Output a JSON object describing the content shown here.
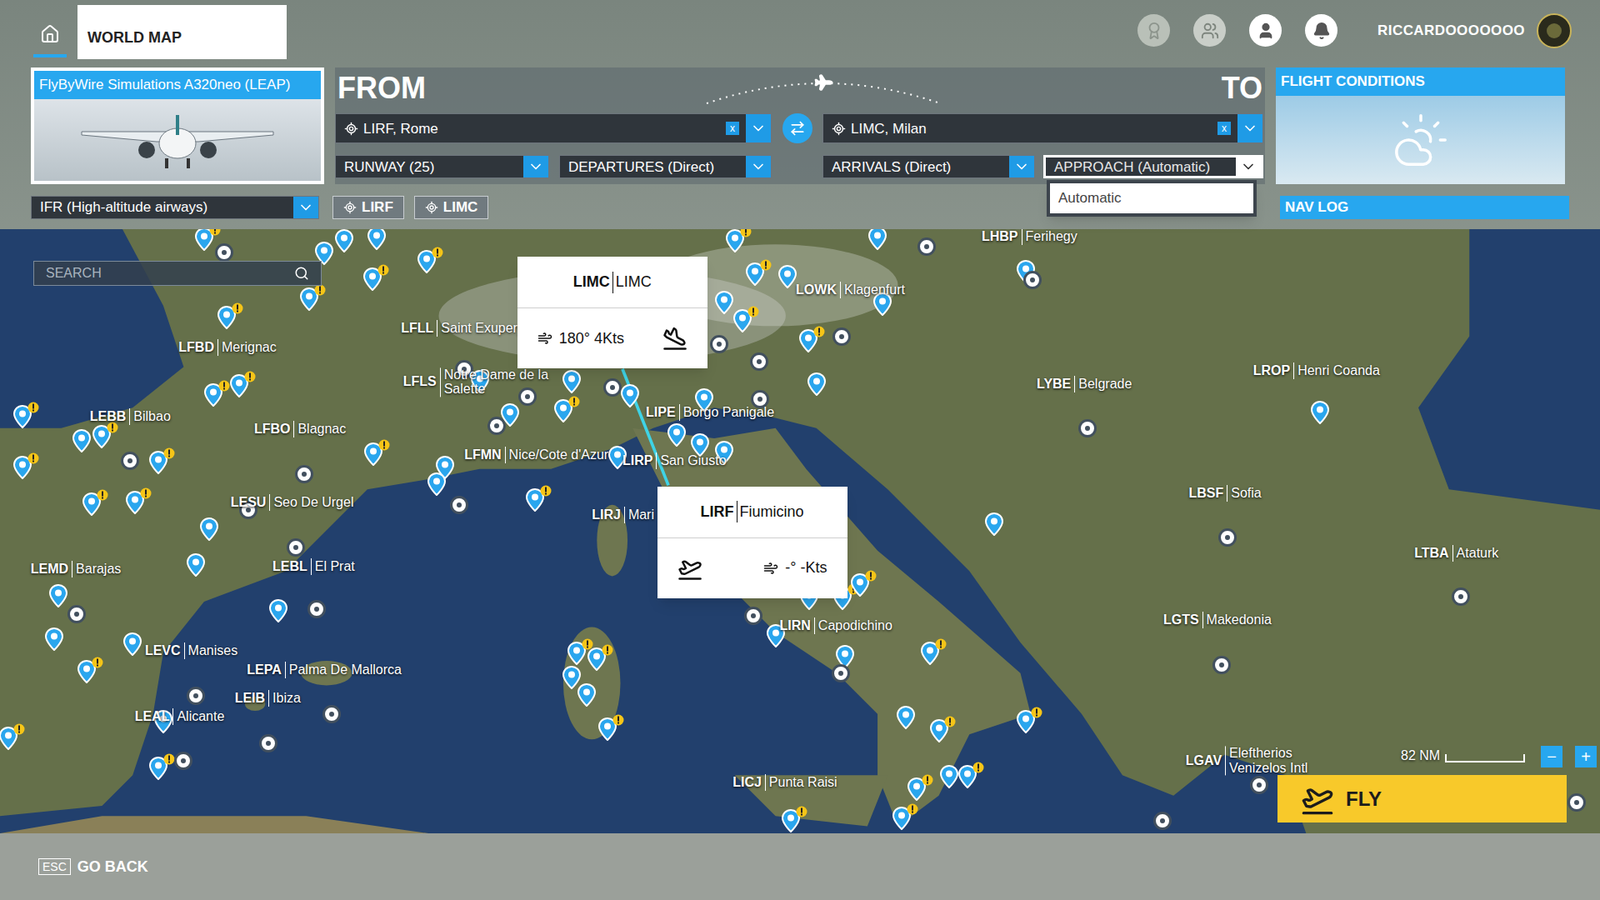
{
  "top_bar": {
    "tab": "WORLD MAP",
    "username": "RICCARDOOOOOOO"
  },
  "aircraft": {
    "name": "FlyByWire Simulations A320neo (LEAP)"
  },
  "route": {
    "from_label": "FROM",
    "to_label": "TO",
    "from": {
      "code": "LIRF",
      "name": "LIRF, Rome"
    },
    "to": {
      "code": "LIMC",
      "name": "LIMC, Milan"
    },
    "clear": "x",
    "runway": "RUNWAY (25)",
    "departures": "DEPARTURES (Direct)",
    "arrivals": "ARRIVALS (Direct)",
    "approach": "APPROACH (Automatic)"
  },
  "approach_menu": {
    "open": true,
    "options": [
      {
        "label": "Automatic",
        "selected": true
      }
    ]
  },
  "flight_conditions": {
    "title": "FLIGHT CONDITIONS"
  },
  "nav_log": "NAV LOG",
  "flight_type": "IFR (High-altitude airways)",
  "waypoints": [
    "LIRF",
    "LIMC"
  ],
  "search": {
    "placeholder": "SEARCH"
  },
  "map": {
    "labels": [
      {
        "code": "LHBP",
        "name": "Ferihegy"
      },
      {
        "code": "LROP",
        "name": "Henri Coanda"
      },
      {
        "code": "LYBE",
        "name": "Belgrade"
      },
      {
        "code": "LBSF",
        "name": "Sofia"
      },
      {
        "code": "LTBA",
        "name": "Ataturk"
      },
      {
        "code": "LGTS",
        "name": "Makedonia"
      },
      {
        "code": "LGAV",
        "name": "Eleftherios Venizelos Intl"
      },
      {
        "code": "LICJ",
        "name": "Punta Raisi"
      },
      {
        "code": "LIRN",
        "name": "Capodichino"
      },
      {
        "code": "LIRJ",
        "name": "Mari"
      },
      {
        "code": "LIRP",
        "name": "San Giusto"
      },
      {
        "code": "LIPE",
        "name": "Borgo Panigale"
      },
      {
        "code": "LFMN",
        "name": "Nice/Cote d'Azur"
      },
      {
        "code": "LFLL",
        "name": "Saint Exupery"
      },
      {
        "code": "LFLS",
        "name": "Notre Dame de la Salette"
      },
      {
        "code": "LFBD",
        "name": "Merignac"
      },
      {
        "code": "LEBB",
        "name": "Bilbao"
      },
      {
        "code": "LFBO",
        "name": "Blagnac"
      },
      {
        "code": "LESU",
        "name": "Seo De Urgel"
      },
      {
        "code": "LEBL",
        "name": "El Prat"
      },
      {
        "code": "LEMD",
        "name": "Barajas"
      },
      {
        "code": "LEVC",
        "name": "Manises"
      },
      {
        "code": "LEPA",
        "name": "Palma De Mallorca"
      },
      {
        "code": "LEIB",
        "name": "Ibiza"
      },
      {
        "code": "LEAL",
        "name": "Alicante"
      },
      {
        "code": "LOWK",
        "name": "Klagenfurt"
      }
    ],
    "popups": [
      {
        "code": "LIMC",
        "name": "LIMC",
        "wind": "180° 4Kts",
        "kind": "arrival"
      },
      {
        "code": "LIRF",
        "name": "Fiumicino",
        "wind": "-° -Kts",
        "kind": "departure"
      }
    ]
  },
  "scale": "82 NM",
  "zoom": {
    "out": "−",
    "in": "+"
  },
  "fly_button": "FLY",
  "footer": {
    "key": "ESC",
    "label": "GO BACK"
  }
}
